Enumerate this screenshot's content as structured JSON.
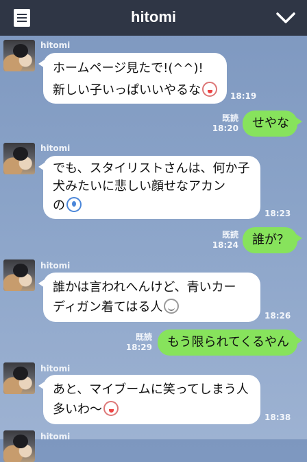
{
  "header": {
    "title": "hitomi"
  },
  "colors": {
    "header_bg": "#2f3645",
    "sent_bubble": "#87e35c",
    "received_bubble": "#ffffff"
  },
  "icons": {
    "menu": "note-icon",
    "collapse": "chevron-down-icon"
  },
  "messages": [
    {
      "from": "hitomi",
      "lines": [
        "ホームページ見たで!(^^)!",
        "新しい子いっぱいいやるな"
      ],
      "emoji": "bunny-emoji",
      "time": "18:19"
    },
    {
      "read": "既読",
      "time": "18:20",
      "lines": [
        "せやな"
      ]
    },
    {
      "from": "hitomi",
      "lines": [
        "でも、スタイリストさんは、何か子",
        "犬みたいに悲しい顔せなアカン",
        "の"
      ],
      "emoji": "crying-emoji",
      "time": "18:23"
    },
    {
      "read": "既読",
      "time": "18:24",
      "lines": [
        "誰が？"
      ]
    },
    {
      "from": "hitomi",
      "lines": [
        "誰かは言われへんけど、青いカー",
        "ディガン着てはる人"
      ],
      "emoji": "smile-emoji",
      "time": "18:26"
    },
    {
      "read": "既読",
      "time": "18:29",
      "lines": [
        "もう限られてくるやん"
      ]
    },
    {
      "from": "hitomi",
      "lines": [
        "あと、マイブームに笑ってしまう人",
        "多いわ〜"
      ],
      "emoji": "bunny-emoji",
      "time": "18:38"
    },
    {
      "from": "hitomi"
    }
  ]
}
